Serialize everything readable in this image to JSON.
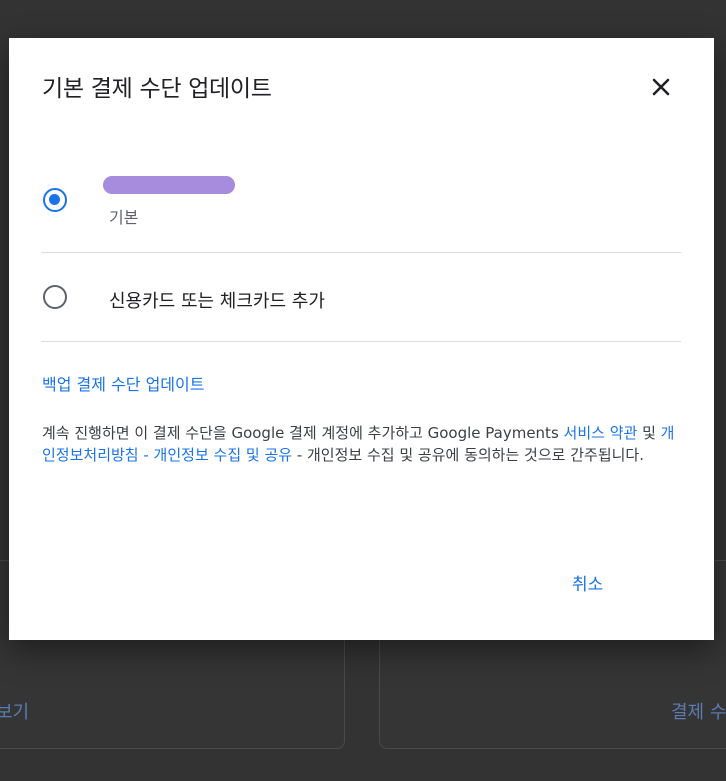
{
  "dialog": {
    "title": "기본 결제 수단 업데이트",
    "close_icon": "close-icon",
    "options": [
      {
        "name": "",
        "sub": "기본",
        "selected": true
      },
      {
        "label": "신용카드 또는 체크카드 추가",
        "selected": false
      }
    ],
    "backup_link": "백업 결제 수단 업데이트",
    "terms": {
      "part1": "계속 진행하면 이 결제 수단을 Google 결제 계정에 추가하고 Google Payments ",
      "link1": "서비스 약관",
      "part2": " 및 ",
      "link2": "개인정보처리방침 - 개인정보 수집 및 공유",
      "part3": " - 개인정보 수집 및 공유에 동의하는 것으로 간주됩니다."
    },
    "cancel_label": "취소"
  },
  "background": {
    "left_link": "보기",
    "right_link": "결제 수"
  },
  "colors": {
    "accent": "#1a73e8",
    "redaction": "#a78bdc",
    "overlay": "#333333"
  }
}
